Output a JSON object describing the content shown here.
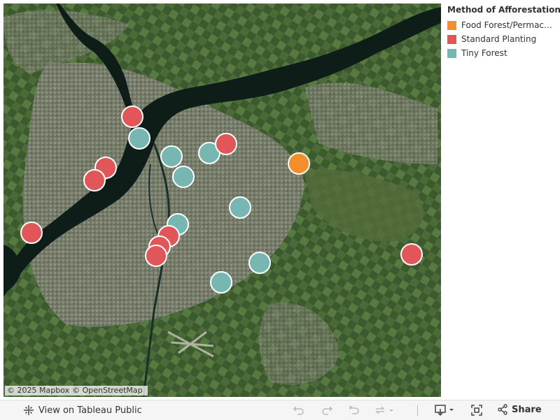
{
  "legend": {
    "title": "Method of Afforestation",
    "items": [
      {
        "label": "Food Forest/Permacu...",
        "color": "#F28E2B"
      },
      {
        "label": "Standard Planting",
        "color": "#E15759"
      },
      {
        "label": "Tiny Forest",
        "color": "#76B7B2"
      }
    ]
  },
  "map": {
    "attribution": {
      "mapbox": "© 2025 Mapbox",
      "osm": "© OpenStreetMap"
    },
    "colors": {
      "land": "#3c5530",
      "urban": "#8a8a80",
      "water": "#0d1a16"
    },
    "points": [
      {
        "category": "Standard Planting"
      },
      {
        "category": "Tiny Forest"
      },
      {
        "category": "Tiny Forest"
      },
      {
        "category": "Tiny Forest"
      },
      {
        "category": "Standard Planting"
      },
      {
        "category": "Food Forest/Permacu..."
      },
      {
        "category": "Standard Planting"
      },
      {
        "category": "Standard Planting"
      },
      {
        "category": "Tiny Forest"
      },
      {
        "category": "Tiny Forest"
      },
      {
        "category": "Standard Planting"
      },
      {
        "category": "Tiny Forest"
      },
      {
        "category": "Standard Planting"
      },
      {
        "category": "Standard Planting"
      },
      {
        "category": "Standard Planting"
      },
      {
        "category": "Tiny Forest"
      },
      {
        "category": "Tiny Forest"
      },
      {
        "category": "Standard Planting"
      }
    ]
  },
  "footer": {
    "view_label": "View on Tableau Public",
    "share_label": "Share",
    "icons": [
      "tableau-logo-icon",
      "undo-icon",
      "redo-icon",
      "revert-icon",
      "refresh-icon",
      "download-icon",
      "fullscreen-icon",
      "share-icon"
    ]
  }
}
